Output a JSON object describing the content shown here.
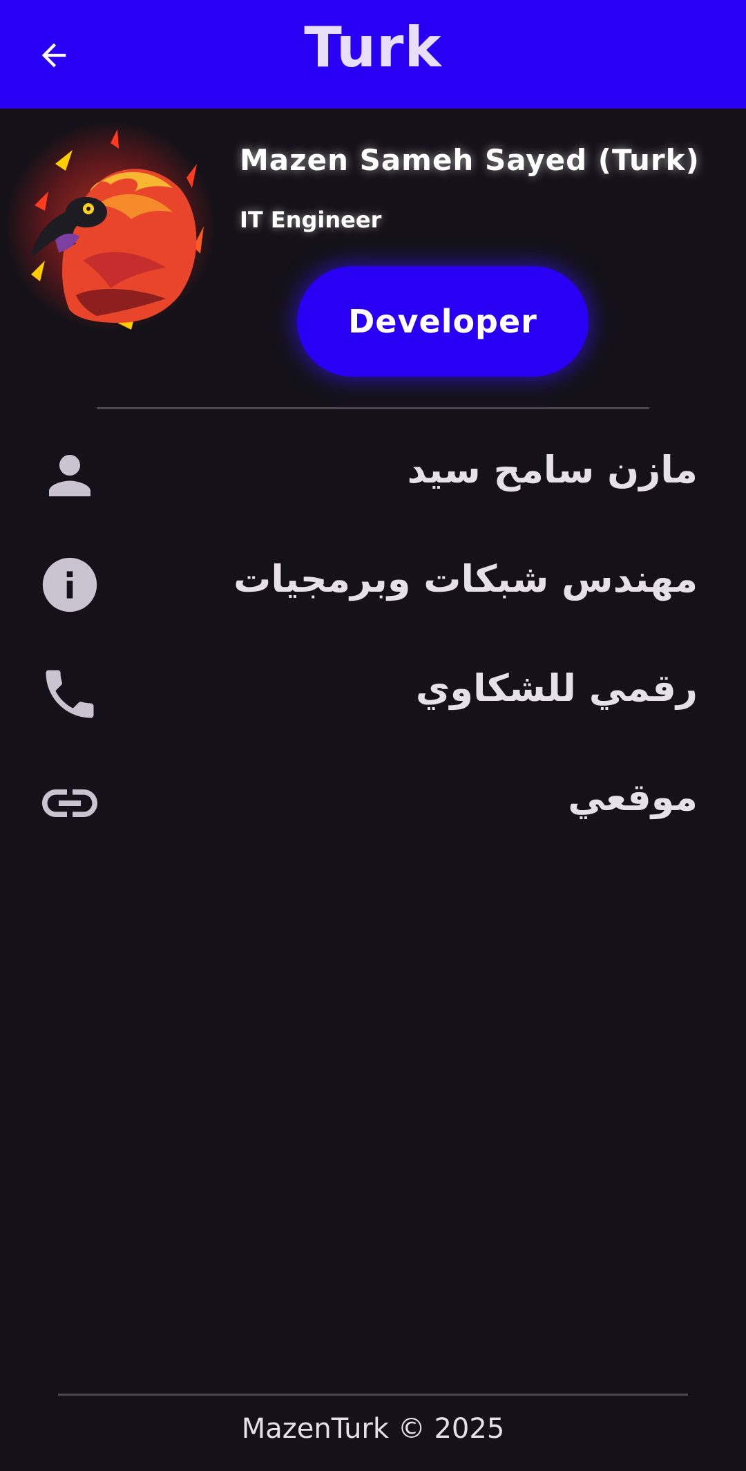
{
  "app_bar": {
    "title": "Turk",
    "back_icon": "arrow-back-icon",
    "background": "#2a00f5"
  },
  "profile": {
    "avatar_icon": "phoenix-avatar-image",
    "name": "Mazen Sameh Sayed (Turk)",
    "role": "IT Engineer",
    "badge_button": "Developer"
  },
  "info_items": [
    {
      "icon": "person-icon",
      "label": "مازن سامح سيد"
    },
    {
      "icon": "info-icon",
      "label": "مهندس شبكات وبرمجيات"
    },
    {
      "icon": "phone-icon",
      "label": "رقمي للشكاوي"
    },
    {
      "icon": "link-icon",
      "label": "موقعي"
    }
  ],
  "footer": {
    "text": "MazenTurk © 2025"
  },
  "colors": {
    "accent": "#2a00f5",
    "background": "#141218",
    "text": "#e6e0e9",
    "icon": "#cac4d0"
  }
}
